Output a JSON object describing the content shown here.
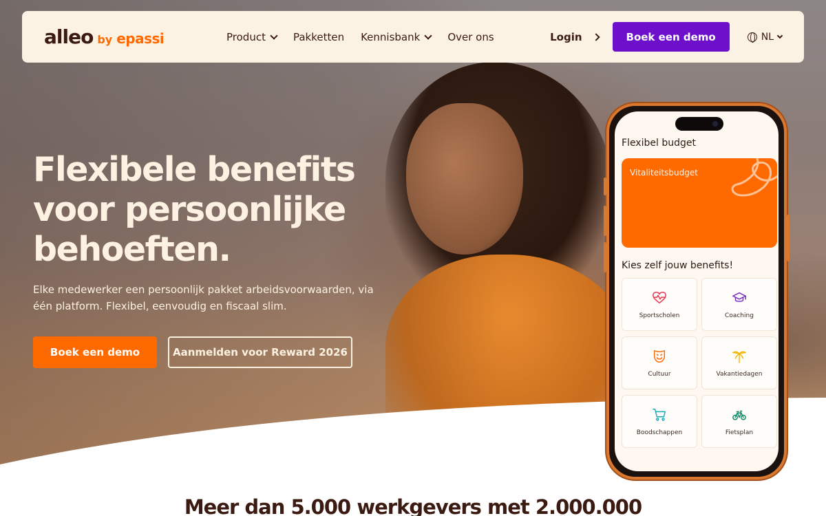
{
  "nav": {
    "logo_main": "alleo",
    "logo_by": "by",
    "logo_brand": "epassi",
    "menu": [
      {
        "label": "Product",
        "dropdown": true
      },
      {
        "label": "Pakketten",
        "dropdown": false
      },
      {
        "label": "Kennisbank",
        "dropdown": true
      },
      {
        "label": "Over ons",
        "dropdown": false
      }
    ],
    "login": "Login",
    "cta": "Boek een demo",
    "language": "NL"
  },
  "hero": {
    "headline_lines": [
      "Flexibele benefits",
      "voor persoonlijke",
      "behoeften."
    ],
    "subtext": "Elke medewerker een persoonlijk pakket arbeidsvoorwaarden, via één platform. Flexibel, eenvoudig en fiscaal slim.",
    "primary_button": "Boek een demo",
    "secondary_button": "Aanmelden voor Reward 2026"
  },
  "phone": {
    "title": "Flexibel budget",
    "card_label": "Vitaliteitsbudget",
    "subtitle": "Kies zelf jouw benefits!",
    "tiles": [
      {
        "label": "Sportscholen",
        "icon": "heart-pulse-icon",
        "color": "#e8344e"
      },
      {
        "label": "Coaching",
        "icon": "graduation-cap-icon",
        "color": "#7a2bc2"
      },
      {
        "label": "Cultuur",
        "icon": "theater-mask-icon",
        "color": "#ff6a00"
      },
      {
        "label": "Vakantiedagen",
        "icon": "palm-tree-icon",
        "color": "#f2b705"
      },
      {
        "label": "Boodschappen",
        "icon": "shopping-cart-icon",
        "color": "#19a8b8"
      },
      {
        "label": "Fietsplan",
        "icon": "bicycle-icon",
        "color": "#0f8a6a"
      }
    ]
  },
  "section": {
    "title": "Meer dan 5.000 werkgevers met 2.000.000"
  },
  "colors": {
    "brand_orange": "#ff6a00",
    "brand_purple": "#6e0fcc",
    "dark_brown": "#3b1a12",
    "cream": "#fbf2e3"
  }
}
